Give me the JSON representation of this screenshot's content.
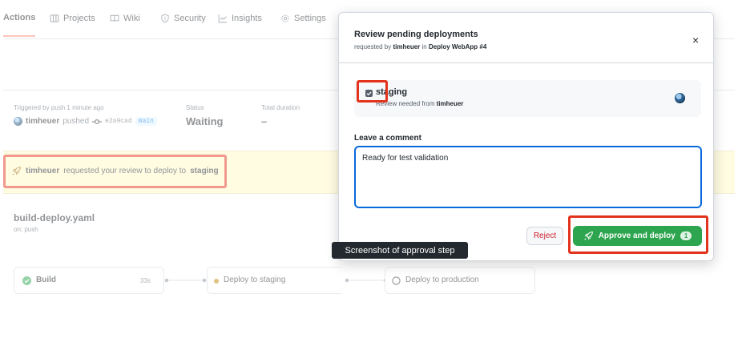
{
  "tabs": [
    {
      "label": "Actions",
      "icon": "actions-icon"
    },
    {
      "label": "Projects",
      "icon": "table-icon"
    },
    {
      "label": "Wiki",
      "icon": "book-icon"
    },
    {
      "label": "Security",
      "icon": "shield-icon"
    },
    {
      "label": "Insights",
      "icon": "graph-icon"
    },
    {
      "label": "Settings",
      "icon": "gear-icon"
    }
  ],
  "summary": {
    "trigger_label": "Triggered by push 1 minute ago",
    "user": "timheuer",
    "pushed_text": "pushed",
    "commit": "e2a9cad",
    "branch": "main",
    "status_label": "Status",
    "status_value": "Waiting",
    "duration_label": "Total duration",
    "duration_value": "–"
  },
  "review_banner": {
    "user": "timheuer",
    "text": "requested your review to deploy to",
    "environment": "staging"
  },
  "workflow": {
    "file": "build-deploy.yaml",
    "trigger": "on: push",
    "jobs": [
      {
        "name": "Build",
        "duration": "33s",
        "state": "success"
      },
      {
        "name": "Deploy to staging",
        "state": "waiting"
      },
      {
        "name": "Deploy to production",
        "state": "pending"
      }
    ]
  },
  "modal": {
    "title": "Review pending deployments",
    "subtitle_prefix": "requested by",
    "subtitle_user": "timheuer",
    "subtitle_in": "in",
    "subtitle_run": "Deploy WebApp #4",
    "close": "×",
    "environment": {
      "name": "staging",
      "review_prefix": "Review needed from",
      "reviewer": "timheuer",
      "checked": true
    },
    "comment_label": "Leave a comment",
    "comment_value": "Ready for test validation",
    "reject_label": "Reject",
    "approve_label": "Approve and deploy",
    "approve_count": "1"
  },
  "tooltip": "Screenshot of approval step",
  "colors": {
    "accent_green": "#2da44e",
    "highlight_red": "#e3331d",
    "banner_yellow": "#fff8c5",
    "link_blue": "#0969da"
  }
}
